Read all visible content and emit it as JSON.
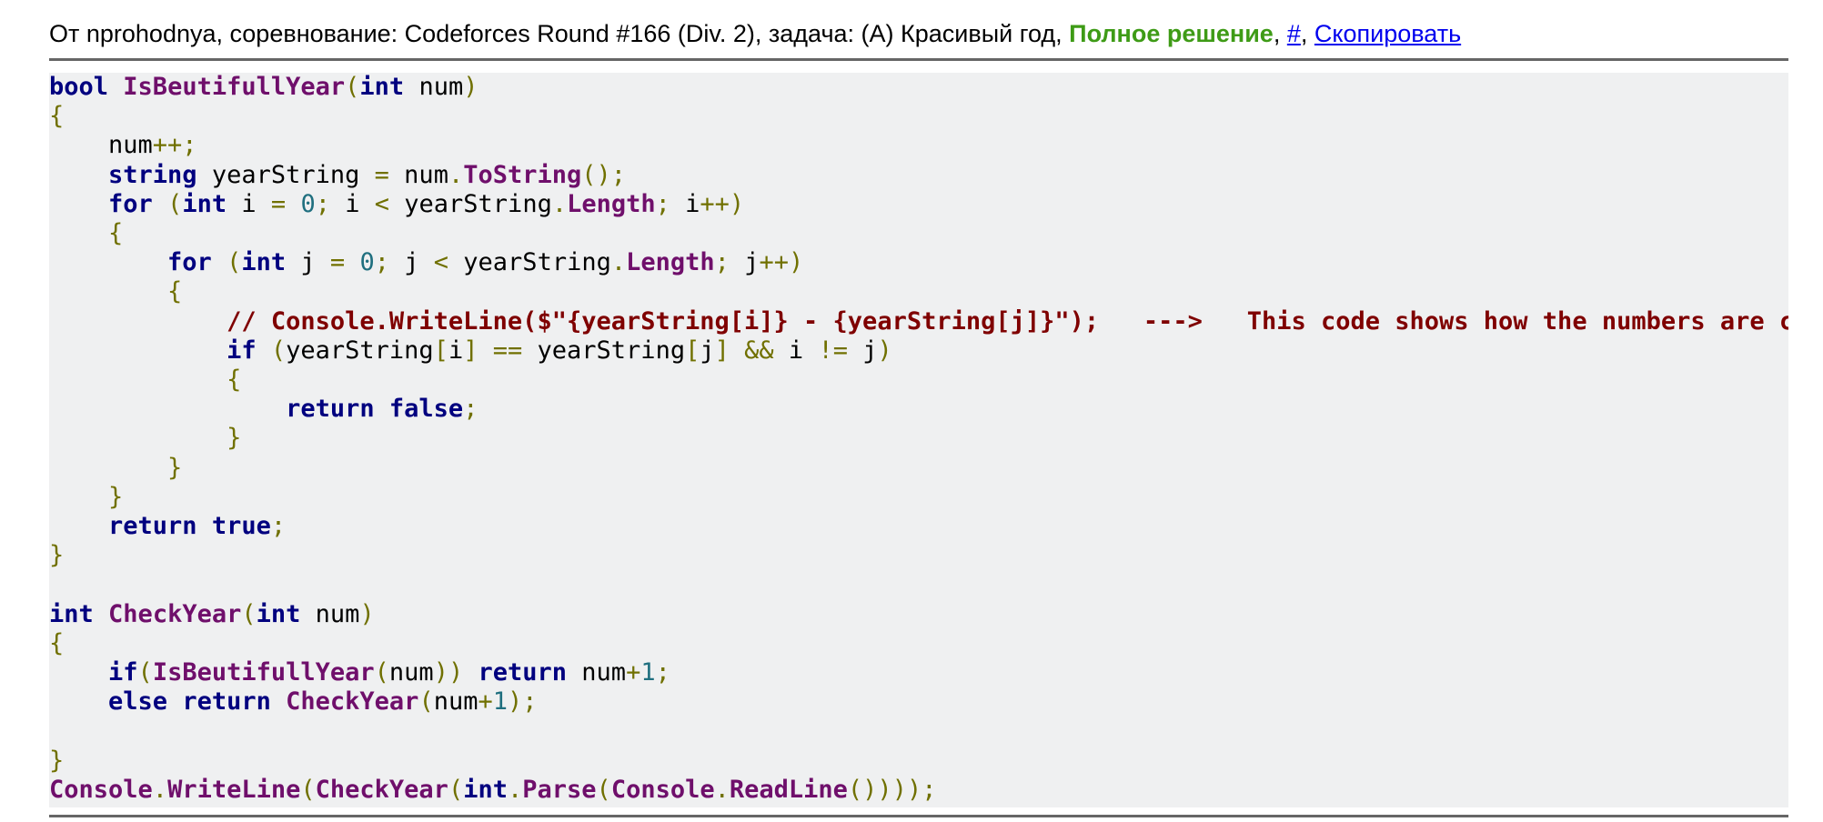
{
  "header": {
    "prefix": "От nprohodnya, соревнование: Codeforces Round #166 (Div. 2), задача: (A) Красивый год, ",
    "verdict": "Полное решение",
    "sep1": ", ",
    "hash_link": "#",
    "sep2": ", ",
    "copy_link": "Скопировать"
  },
  "code": {
    "language": "C#",
    "lines": [
      [
        [
          "kw",
          "bool"
        ],
        [
          "p",
          " "
        ],
        [
          "fn",
          "IsBeutifullYear"
        ],
        [
          "op",
          "("
        ],
        [
          "kw",
          "int"
        ],
        [
          "p",
          " num"
        ],
        [
          "op",
          ")"
        ]
      ],
      [
        [
          "op",
          "{"
        ]
      ],
      [
        [
          "p",
          "    num"
        ],
        [
          "op",
          "++;"
        ]
      ],
      [
        [
          "p",
          "    "
        ],
        [
          "kw",
          "string"
        ],
        [
          "p",
          " yearString "
        ],
        [
          "op",
          "="
        ],
        [
          "p",
          " num"
        ],
        [
          "op",
          "."
        ],
        [
          "fn",
          "ToString"
        ],
        [
          "op",
          "();"
        ]
      ],
      [
        [
          "p",
          "    "
        ],
        [
          "kw",
          "for"
        ],
        [
          "p",
          " "
        ],
        [
          "op",
          "("
        ],
        [
          "kw",
          "int"
        ],
        [
          "p",
          " i "
        ],
        [
          "op",
          "="
        ],
        [
          "p",
          " "
        ],
        [
          "num",
          "0"
        ],
        [
          "op",
          ";"
        ],
        [
          "p",
          " i "
        ],
        [
          "op",
          "<"
        ],
        [
          "p",
          " yearString"
        ],
        [
          "op",
          "."
        ],
        [
          "fn",
          "Length"
        ],
        [
          "op",
          ";"
        ],
        [
          "p",
          " i"
        ],
        [
          "op",
          "++)"
        ]
      ],
      [
        [
          "p",
          "    "
        ],
        [
          "op",
          "{"
        ]
      ],
      [
        [
          "p",
          "        "
        ],
        [
          "kw",
          "for"
        ],
        [
          "p",
          " "
        ],
        [
          "op",
          "("
        ],
        [
          "kw",
          "int"
        ],
        [
          "p",
          " j "
        ],
        [
          "op",
          "="
        ],
        [
          "p",
          " "
        ],
        [
          "num",
          "0"
        ],
        [
          "op",
          ";"
        ],
        [
          "p",
          " j "
        ],
        [
          "op",
          "<"
        ],
        [
          "p",
          " yearString"
        ],
        [
          "op",
          "."
        ],
        [
          "fn",
          "Length"
        ],
        [
          "op",
          ";"
        ],
        [
          "p",
          " j"
        ],
        [
          "op",
          "++)"
        ]
      ],
      [
        [
          "p",
          "        "
        ],
        [
          "op",
          "{"
        ]
      ],
      [
        [
          "p",
          "            "
        ],
        [
          "cm",
          "// Console.WriteLine($\"{yearString[i]} - {yearString[j]}\");   --->   This code shows how the numbers are comp"
        ]
      ],
      [
        [
          "p",
          "            "
        ],
        [
          "kw",
          "if"
        ],
        [
          "p",
          " "
        ],
        [
          "op",
          "("
        ],
        [
          "p",
          "yearString"
        ],
        [
          "op",
          "["
        ],
        [
          "p",
          "i"
        ],
        [
          "op",
          "]"
        ],
        [
          "p",
          " "
        ],
        [
          "op",
          "=="
        ],
        [
          "p",
          " yearString"
        ],
        [
          "op",
          "["
        ],
        [
          "p",
          "j"
        ],
        [
          "op",
          "]"
        ],
        [
          "p",
          " "
        ],
        [
          "op",
          "&&"
        ],
        [
          "p",
          " i "
        ],
        [
          "op",
          "!="
        ],
        [
          "p",
          " j"
        ],
        [
          "op",
          ")"
        ]
      ],
      [
        [
          "p",
          "            "
        ],
        [
          "op",
          "{"
        ]
      ],
      [
        [
          "p",
          "                "
        ],
        [
          "kw",
          "return"
        ],
        [
          "p",
          " "
        ],
        [
          "kw",
          "false"
        ],
        [
          "op",
          ";"
        ]
      ],
      [
        [
          "p",
          "            "
        ],
        [
          "op",
          "}"
        ]
      ],
      [
        [
          "p",
          "        "
        ],
        [
          "op",
          "}"
        ]
      ],
      [
        [
          "p",
          "    "
        ],
        [
          "op",
          "}"
        ]
      ],
      [
        [
          "p",
          "    "
        ],
        [
          "kw",
          "return"
        ],
        [
          "p",
          " "
        ],
        [
          "kw",
          "true"
        ],
        [
          "op",
          ";"
        ]
      ],
      [
        [
          "op",
          "}"
        ]
      ],
      [],
      [
        [
          "kw",
          "int"
        ],
        [
          "p",
          " "
        ],
        [
          "fn",
          "CheckYear"
        ],
        [
          "op",
          "("
        ],
        [
          "kw",
          "int"
        ],
        [
          "p",
          " num"
        ],
        [
          "op",
          ")"
        ]
      ],
      [
        [
          "op",
          "{"
        ]
      ],
      [
        [
          "p",
          "    "
        ],
        [
          "kw",
          "if"
        ],
        [
          "op",
          "("
        ],
        [
          "fn",
          "IsBeutifullYear"
        ],
        [
          "op",
          "("
        ],
        [
          "p",
          "num"
        ],
        [
          "op",
          "))"
        ],
        [
          "p",
          " "
        ],
        [
          "kw",
          "return"
        ],
        [
          "p",
          " num"
        ],
        [
          "op",
          "+"
        ],
        [
          "num",
          "1"
        ],
        [
          "op",
          ";"
        ]
      ],
      [
        [
          "p",
          "    "
        ],
        [
          "kw",
          "else"
        ],
        [
          "p",
          " "
        ],
        [
          "kw",
          "return"
        ],
        [
          "p",
          " "
        ],
        [
          "fn",
          "CheckYear"
        ],
        [
          "op",
          "("
        ],
        [
          "p",
          "num"
        ],
        [
          "op",
          "+"
        ],
        [
          "num",
          "1"
        ],
        [
          "op",
          ");"
        ]
      ],
      [],
      [
        [
          "op",
          "}"
        ]
      ],
      [
        [
          "fn",
          "Console"
        ],
        [
          "op",
          "."
        ],
        [
          "fn",
          "WriteLine"
        ],
        [
          "op",
          "("
        ],
        [
          "fn",
          "CheckYear"
        ],
        [
          "op",
          "("
        ],
        [
          "kw",
          "int"
        ],
        [
          "op",
          "."
        ],
        [
          "fn",
          "Parse"
        ],
        [
          "op",
          "("
        ],
        [
          "fn",
          "Console"
        ],
        [
          "op",
          "."
        ],
        [
          "fn",
          "ReadLine"
        ],
        [
          "op",
          "()))); "
        ]
      ]
    ]
  }
}
